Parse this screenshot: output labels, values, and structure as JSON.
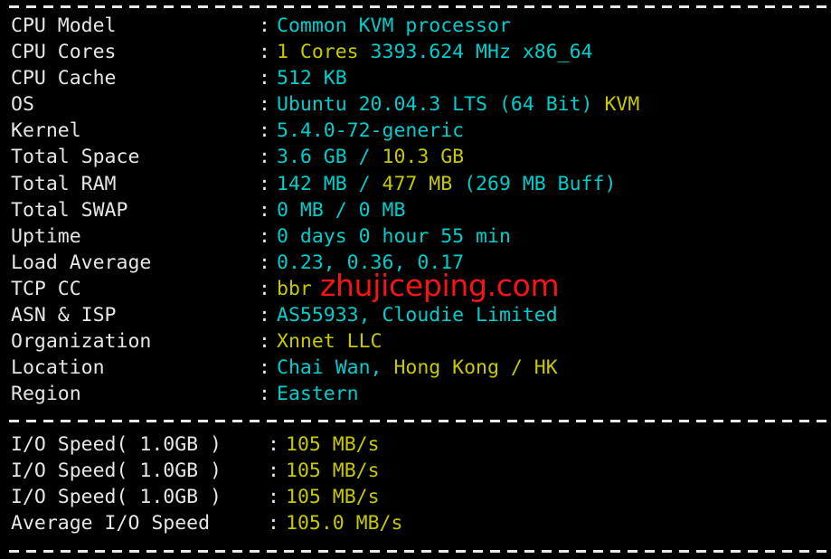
{
  "terminal": {
    "background_color": "#000000",
    "label_color": "#e6e6e6",
    "value_cyan": "#00cdcd",
    "value_yellow": "#c8c800",
    "watermark_color": "#f51515",
    "separator_char": "-"
  },
  "watermark": {
    "text": "zhujiceping.com"
  },
  "colon": ":",
  "sysinfo": [
    {
      "label": "CPU Model",
      "parts": [
        {
          "text": "Common KVM processor",
          "color": "cyan"
        }
      ]
    },
    {
      "label": "CPU Cores",
      "parts": [
        {
          "text": "1 Cores",
          "color": "yellow"
        },
        {
          "text": " 3393.624 MHz x86_64",
          "color": "cyan"
        }
      ]
    },
    {
      "label": "CPU Cache",
      "parts": [
        {
          "text": "512 KB",
          "color": "cyan"
        }
      ]
    },
    {
      "label": "OS",
      "parts": [
        {
          "text": "Ubuntu 20.04.3 LTS (64 Bit) ",
          "color": "cyan"
        },
        {
          "text": "KVM",
          "color": "yellow"
        }
      ]
    },
    {
      "label": "Kernel",
      "parts": [
        {
          "text": "5.4.0-72-generic",
          "color": "cyan"
        }
      ]
    },
    {
      "label": "Total Space",
      "parts": [
        {
          "text": "3.6 GB / ",
          "color": "cyan"
        },
        {
          "text": "10.3 GB",
          "color": "yellow"
        }
      ]
    },
    {
      "label": "Total RAM",
      "parts": [
        {
          "text": "142 MB / ",
          "color": "cyan"
        },
        {
          "text": "477 MB",
          "color": "yellow"
        },
        {
          "text": " (269 MB Buff)",
          "color": "cyan"
        }
      ]
    },
    {
      "label": "Total SWAP",
      "parts": [
        {
          "text": "0 MB / 0 MB",
          "color": "cyan"
        }
      ]
    },
    {
      "label": "Uptime",
      "parts": [
        {
          "text": "0 days 0 hour 55 min",
          "color": "cyan"
        }
      ]
    },
    {
      "label": "Load Average",
      "parts": [
        {
          "text": "0.23, 0.36, 0.17",
          "color": "cyan"
        }
      ]
    },
    {
      "label": "TCP CC",
      "parts": [
        {
          "text": "bbr",
          "color": "yellow"
        }
      ]
    },
    {
      "label": "ASN & ISP",
      "parts": [
        {
          "text": "AS55933, Cloudie Limited",
          "color": "cyan"
        }
      ]
    },
    {
      "label": "Organization",
      "parts": [
        {
          "text": "Xnnet LLC",
          "color": "yellow"
        }
      ]
    },
    {
      "label": "Location",
      "parts": [
        {
          "text": "Chai Wan, ",
          "color": "cyan"
        },
        {
          "text": "Hong Kong / HK",
          "color": "yellow"
        }
      ]
    },
    {
      "label": "Region",
      "parts": [
        {
          "text": "Eastern",
          "color": "cyan"
        }
      ]
    }
  ],
  "iospeed": [
    {
      "label": "I/O Speed( 1.0GB )",
      "parts": [
        {
          "text": "105 MB/s",
          "color": "yellow"
        }
      ]
    },
    {
      "label": "I/O Speed( 1.0GB )",
      "parts": [
        {
          "text": "105 MB/s",
          "color": "yellow"
        }
      ]
    },
    {
      "label": "I/O Speed( 1.0GB )",
      "parts": [
        {
          "text": "105 MB/s",
          "color": "yellow"
        }
      ]
    },
    {
      "label": "Average I/O Speed",
      "parts": [
        {
          "text": "105.0 MB/s",
          "color": "yellow"
        }
      ]
    }
  ]
}
